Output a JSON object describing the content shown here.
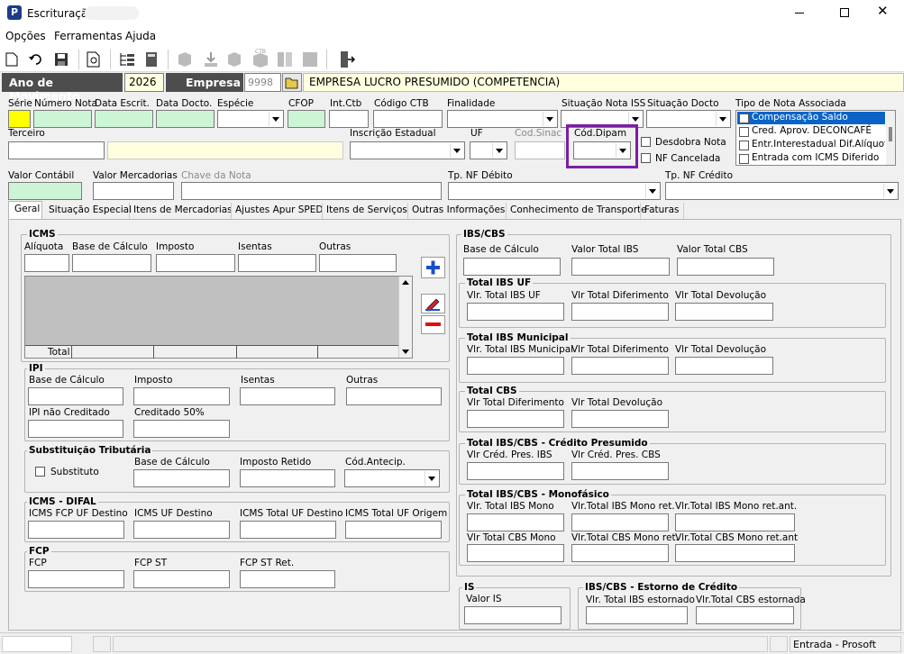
{
  "window": {
    "title": "Escrituração",
    "icon_letter": "P"
  },
  "menu": [
    "Opções",
    "Ferramentas",
    "Ajuda"
  ],
  "header": {
    "ano_label": "Ano de Movimento",
    "ano_value": "2026",
    "empresa_label": "Empresa",
    "empresa_code": "9998",
    "empresa_name": "EMPRESA LUCRO PRESUMIDO (COMPETENCIA)"
  },
  "fields": {
    "serie": "Série",
    "numero_nota": "Número Nota",
    "data_escrit": "Data Escrit.",
    "data_docto": "Data Docto.",
    "especie": "Espécie",
    "cfop": "CFOP",
    "int_ctb": "Int.Ctb",
    "codigo_ctb": "Código CTB",
    "finalidade": "Finalidade",
    "situacao_nota_iss": "Situação Nota ISS",
    "situacao_docto": "Situação Docto",
    "tipo_nota_associada": "Tipo de Nota Associada",
    "terceiro": "Terceiro",
    "inscricao_estadual": "Inscrição Estadual",
    "uf": "UF",
    "cod_sinac": "Cod.Sinac",
    "cod_dipam": "Cód.Dipam",
    "desdobra_nota": "Desdobra Nota",
    "nf_cancelada": "NF Cancelada",
    "valor_contabil": "Valor Contábil",
    "valor_mercadorias": "Valor Mercadorias",
    "chave_nota": "Chave da Nota",
    "tp_nf_debito": "Tp. NF Débito",
    "tp_nf_credito": "Tp. NF Crédito"
  },
  "tipo_nota_list": [
    "Compensação Saldo",
    "Cred. Aprov. DECONCAFÉ",
    "Entr.Interestadual Dif.Alíquota",
    "Entrada com ICMS Diferido"
  ],
  "tabs": [
    "Geral",
    "Situação Especial",
    "Itens de Mercadorias",
    "Ajustes Apur SPED",
    "Itens de Serviços",
    "Outras Informações",
    "Conhecimento de Transporte",
    "Faturas"
  ],
  "icms": {
    "title": "ICMS",
    "cols": [
      "Alíquota",
      "Base de Cálculo",
      "Imposto",
      "Isentas",
      "Outras"
    ],
    "total": "Total"
  },
  "ipi": {
    "title": "IPI",
    "base": "Base de Cálculo",
    "imposto": "Imposto",
    "isentas": "Isentas",
    "outras": "Outras",
    "nao_creditado": "IPI não Creditado",
    "creditado50": "Creditado 50%"
  },
  "st": {
    "title": "Substituição Tributária",
    "substituto": "Substituto",
    "base": "Base de Cálculo",
    "retido": "Imposto Retido",
    "antecip": "Cód.Antecip."
  },
  "difal": {
    "title": "ICMS - DIFAL",
    "fcp_uf": "ICMS FCP UF Destino",
    "uf_dest": "ICMS UF Destino",
    "total_uf": "ICMS Total UF Destino",
    "uf_orig": "ICMS Total UF Origem"
  },
  "fcp": {
    "title": "FCP",
    "fcp": "FCP",
    "fcp_st": "FCP ST",
    "fcp_st_ret": "FCP ST Ret."
  },
  "ibscbs": {
    "title": "IBS/CBS",
    "base": "Base de Cálculo",
    "v_ibs": "Valor Total IBS",
    "v_cbs": "Valor Total CBS",
    "uf_title": "Total IBS UF",
    "uf_a": "Vlr. Total IBS UF",
    "uf_b": "Vlr Total Diferimento",
    "uf_c": "Vlr Total Devolução",
    "mun_title": "Total IBS Municipal",
    "mun_a": "Vlr. Total IBS Municipal",
    "mun_b": "Vlr Total Diferimento",
    "mun_c": "Vlr Total Devolução",
    "cbs_title": "Total CBS",
    "cbs_a": "Vlr Total Diferimento",
    "cbs_b": "Vlr Total Devolução",
    "cp_title": "Total IBS/CBS - Crédito Presumido",
    "cp_a": "Vlr Créd. Pres. IBS",
    "cp_b": "Vlr Créd. Pres. CBS",
    "mono_title": "Total IBS/CBS - Monofásico",
    "mono_a": "Vlr. Total IBS Mono",
    "mono_b": "Vlr.Total IBS Mono ret.",
    "mono_c": "Vlr.Total IBS Mono ret.ant.",
    "mono_d": "Vlr Total CBS Mono",
    "mono_e": "Vlr.Total CBS Mono ret.",
    "mono_f": "Vlr.Total CBS Mono ret.ant"
  },
  "is": {
    "title": "IS",
    "valor": "Valor IS"
  },
  "estorno": {
    "title": "IBS/CBS - Estorno de Crédito",
    "ibs": "Vlr. Total IBS estornado",
    "cbs": "Vlr.Total CBS estornada"
  },
  "status": {
    "mode": "Entrada - Prosoft"
  }
}
